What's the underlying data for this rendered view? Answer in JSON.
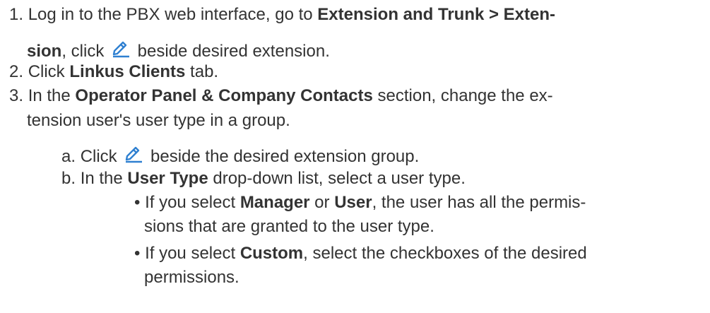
{
  "doc": {
    "step1": {
      "num": "1. ",
      "t1": "Log in to the PBX web interface, go to ",
      "b1": "Extension and Trunk > Exten-",
      "b2": "sion",
      "t2": ", click ",
      "icon": "edit-icon",
      "t3": " beside desired extension."
    },
    "step2": {
      "num": "2. ",
      "t1": "Click ",
      "b1": "Linkus Clients",
      "t2": " tab."
    },
    "step3": {
      "num": "3. ",
      "t1": "In the ",
      "b1": "Operator Panel & Company Contacts",
      "t2": " section, change the ex-",
      "t3": "tension user's user type in a group."
    },
    "substep_a": {
      "label": "a. ",
      "t1": "Click ",
      "icon": "edit-icon",
      "t2": " beside the desired extension group."
    },
    "substep_b": {
      "label": "b. ",
      "t1": "In the ",
      "b1": "User Type",
      "t2": " drop-down list, select a user type."
    },
    "bullet1": {
      "bullet": "• ",
      "t1": "If you select ",
      "b1": "Manager",
      "t2": " or ",
      "b2": "User",
      "t3": ", the user has all the permis-",
      "t4": "sions that are granted to the user type."
    },
    "bullet2": {
      "bullet": "• ",
      "t1": "If you select ",
      "b1": "Custom",
      "t2": ", select the checkboxes of the desired",
      "t3": "permissions."
    },
    "colors": {
      "text": "#333333",
      "icon": "#2f80d1"
    }
  }
}
